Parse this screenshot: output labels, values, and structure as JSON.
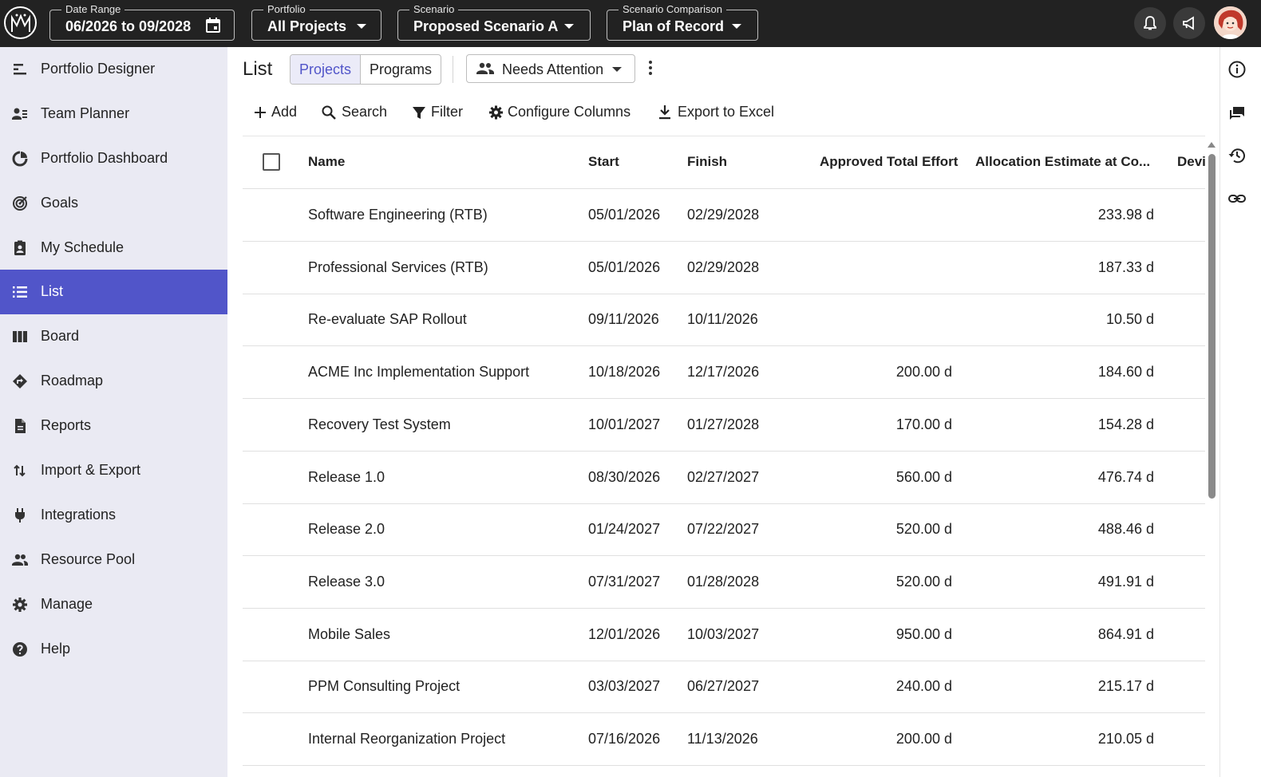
{
  "topbar": {
    "logo_icon": "mavenlink-logo-icon",
    "date_range": {
      "label": "Date Range",
      "value": "06/2026 to 09/2028"
    },
    "portfolio": {
      "label": "Portfolio",
      "value": "All Projects"
    },
    "scenario": {
      "label": "Scenario",
      "value": "Proposed Scenario A"
    },
    "scenario_comparison": {
      "label": "Scenario Comparison",
      "value": "Plan of Record"
    }
  },
  "sidebar": {
    "items": [
      {
        "label": "Portfolio Designer",
        "icon": "portfolio-designer-icon"
      },
      {
        "label": "Team Planner",
        "icon": "team-planner-icon"
      },
      {
        "label": "Portfolio Dashboard",
        "icon": "dashboard-icon"
      },
      {
        "label": "Goals",
        "icon": "target-icon"
      },
      {
        "label": "My Schedule",
        "icon": "schedule-icon"
      },
      {
        "label": "List",
        "icon": "list-icon",
        "active": true
      },
      {
        "label": "Board",
        "icon": "board-icon"
      },
      {
        "label": "Roadmap",
        "icon": "roadmap-icon"
      },
      {
        "label": "Reports",
        "icon": "reports-icon"
      },
      {
        "label": "Import & Export",
        "icon": "import-export-icon"
      },
      {
        "label": "Integrations",
        "icon": "plug-icon"
      },
      {
        "label": "Resource Pool",
        "icon": "people-icon"
      },
      {
        "label": "Manage",
        "icon": "gear-icon"
      },
      {
        "label": "Help",
        "icon": "help-icon"
      }
    ]
  },
  "main": {
    "title": "List",
    "tabs": [
      "Projects",
      "Programs"
    ],
    "view_select": "Needs Attention",
    "toolbar": {
      "add": "Add",
      "search": "Search",
      "filter": "Filter",
      "configure": "Configure Columns",
      "export": "Export to Excel"
    }
  },
  "table": {
    "columns": [
      "Name",
      "Start",
      "Finish",
      "Approved Total Effort",
      "Allocation Estimate at Co...",
      "Devi"
    ],
    "rows": [
      {
        "name": "Software Engineering (RTB)",
        "start": "05/01/2026",
        "finish": "02/29/2028",
        "approved": "",
        "allocation": "233.98 d"
      },
      {
        "name": "Professional Services (RTB)",
        "start": "05/01/2026",
        "finish": "02/29/2028",
        "approved": "",
        "allocation": "187.33 d"
      },
      {
        "name": "Re-evaluate SAP Rollout",
        "start": "09/11/2026",
        "finish": "10/11/2026",
        "approved": "",
        "allocation": "10.50 d"
      },
      {
        "name": "ACME Inc Implementation Support",
        "start": "10/18/2026",
        "finish": "12/17/2026",
        "approved": "200.00 d",
        "allocation": "184.60 d"
      },
      {
        "name": "Recovery Test System",
        "start": "10/01/2027",
        "finish": "01/27/2028",
        "approved": "170.00 d",
        "allocation": "154.28 d"
      },
      {
        "name": "Release 1.0",
        "start": "08/30/2026",
        "finish": "02/27/2027",
        "approved": "560.00 d",
        "allocation": "476.74 d"
      },
      {
        "name": "Release 2.0",
        "start": "01/24/2027",
        "finish": "07/22/2027",
        "approved": "520.00 d",
        "allocation": "488.46 d"
      },
      {
        "name": "Release 3.0",
        "start": "07/31/2027",
        "finish": "01/28/2028",
        "approved": "520.00 d",
        "allocation": "491.91 d"
      },
      {
        "name": "Mobile Sales",
        "start": "12/01/2026",
        "finish": "10/03/2027",
        "approved": "950.00 d",
        "allocation": "864.91 d"
      },
      {
        "name": "PPM Consulting Project",
        "start": "03/03/2027",
        "finish": "06/27/2027",
        "approved": "240.00 d",
        "allocation": "215.17 d"
      },
      {
        "name": "Internal Reorganization Project",
        "start": "07/16/2026",
        "finish": "11/13/2026",
        "approved": "200.00 d",
        "allocation": "210.05 d"
      }
    ]
  },
  "colors": {
    "topbar_bg": "#222222",
    "sidebar_bg": "#eaeaf3",
    "accent": "#5155c9"
  }
}
